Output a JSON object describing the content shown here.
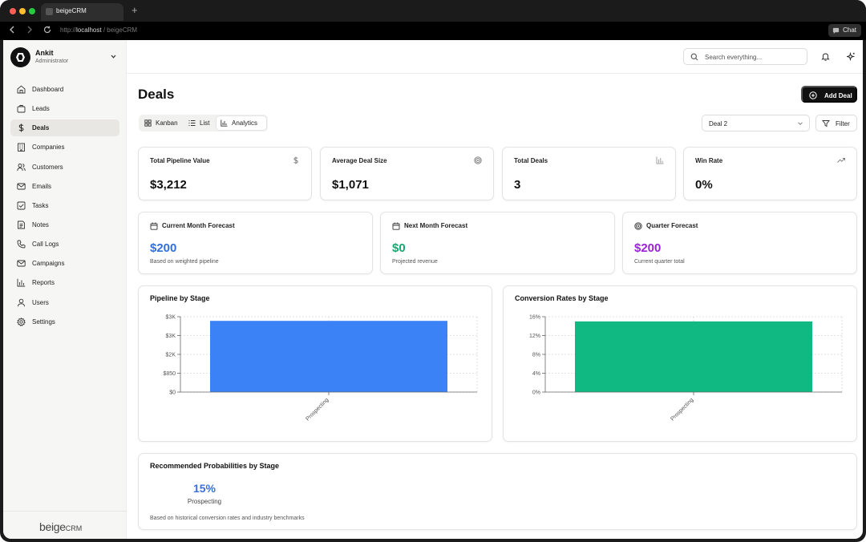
{
  "browser": {
    "tab_title": "beigeCRM",
    "new_tab": "+",
    "url_scheme": "http://",
    "url_host": "localhost",
    "url_path": " / beigeCRM",
    "chat_label": "Chat"
  },
  "user": {
    "name": "Ankit",
    "role": "Administrator"
  },
  "nav": [
    {
      "label": "Dashboard",
      "icon": "home-icon"
    },
    {
      "label": "Leads",
      "icon": "briefcase-icon"
    },
    {
      "label": "Deals",
      "icon": "dollar-icon",
      "active": true
    },
    {
      "label": "Companies",
      "icon": "building-icon"
    },
    {
      "label": "Customers",
      "icon": "users-icon"
    },
    {
      "label": "Emails",
      "icon": "mail-icon"
    },
    {
      "label": "Tasks",
      "icon": "checkbox-icon"
    },
    {
      "label": "Notes",
      "icon": "note-icon"
    },
    {
      "label": "Call Logs",
      "icon": "phone-icon"
    },
    {
      "label": "Campaigns",
      "icon": "campaign-mail-icon"
    },
    {
      "label": "Reports",
      "icon": "bar-chart-icon"
    },
    {
      "label": "Users",
      "icon": "user-icon"
    },
    {
      "label": "Settings",
      "icon": "gear-icon"
    }
  ],
  "brand": {
    "name": "beige",
    "suffix": "CRM"
  },
  "topbar": {
    "search_placeholder": "Search everything..."
  },
  "page": {
    "title": "Deals",
    "add_button": "Add Deal",
    "views": [
      "Kanban",
      "List",
      "Analytics"
    ],
    "active_view": "Analytics",
    "deal_select": "Deal 2",
    "filter_label": "Filter"
  },
  "stats": [
    {
      "label": "Total Pipeline Value",
      "value": "$3,212",
      "icon": "dollar-icon"
    },
    {
      "label": "Average Deal Size",
      "value": "$1,071",
      "icon": "target-icon"
    },
    {
      "label": "Total Deals",
      "value": "3",
      "icon": "bar-chart-icon"
    },
    {
      "label": "Win Rate",
      "value": "0%",
      "icon": "trending-up-icon"
    }
  ],
  "forecasts": [
    {
      "label": "Current Month Forecast",
      "value": "$200",
      "sub": "Based on weighted pipeline",
      "color": "#2f6fe0",
      "icon": "calendar-icon"
    },
    {
      "label": "Next Month Forecast",
      "value": "$0",
      "sub": "Projected revenue",
      "color": "#16a870",
      "icon": "calendar-icon"
    },
    {
      "label": "Quarter Forecast",
      "value": "$200",
      "sub": "Current quarter total",
      "color": "#9b22d8",
      "icon": "target-icon"
    }
  ],
  "chart_data": [
    {
      "type": "bar",
      "title": "Pipeline by Stage",
      "categories": [
        "Prospecting"
      ],
      "values": [
        3212
      ],
      "ylim": [
        0,
        3400
      ],
      "yticks": [
        0,
        850,
        1700,
        2550,
        3400
      ],
      "ytick_labels": [
        "$0",
        "$850",
        "$2K",
        "$3K",
        "$3K"
      ],
      "color": "#3b82f6",
      "grid": true
    },
    {
      "type": "bar",
      "title": "Conversion Rates by Stage",
      "categories": [
        "Prospecting"
      ],
      "values": [
        15
      ],
      "ylim": [
        0,
        16
      ],
      "yticks": [
        0,
        4,
        8,
        12,
        16
      ],
      "ytick_labels": [
        "0%",
        "4%",
        "8%",
        "12%",
        "16%"
      ],
      "color": "#10b981",
      "grid": true
    }
  ],
  "probabilities": {
    "title": "Recommended Probabilities by Stage",
    "items": [
      {
        "value": "15%",
        "stage": "Prospecting"
      }
    ],
    "note": "Based on historical conversion rates and industry benchmarks"
  }
}
